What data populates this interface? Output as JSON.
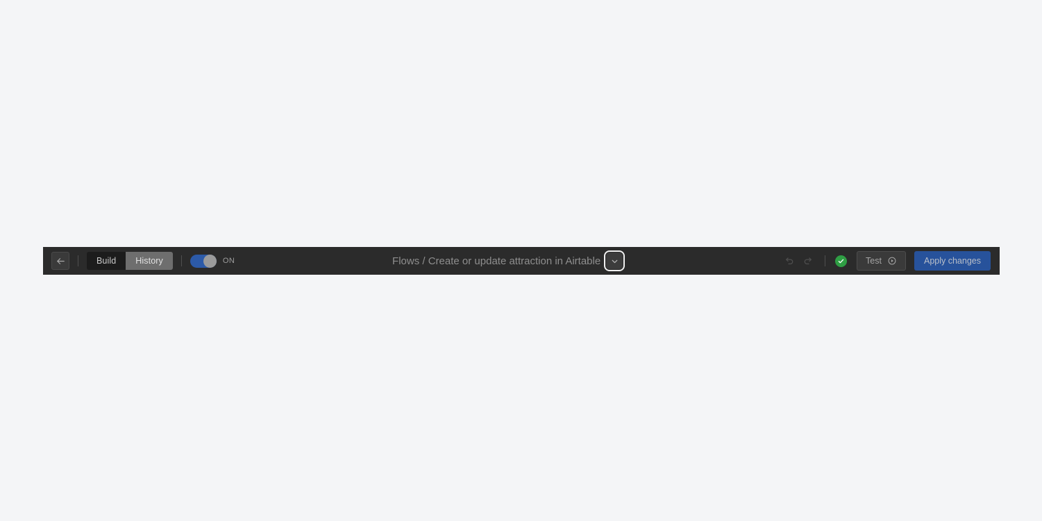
{
  "theme": {
    "page_background": "#f4f5f7",
    "toolbar_background": "#2b2b2b",
    "accent_blue": "#27529b",
    "toggle_on_blue": "#2c5aa8",
    "status_green": "#2f9e44",
    "muted_text": "#8e8e8e"
  },
  "toolbar": {
    "back_button": {
      "icon": "arrow-left-icon",
      "label": ""
    },
    "mode_tabs": [
      {
        "label": "Build",
        "active": true
      },
      {
        "label": "History",
        "active": false
      }
    ],
    "enable_toggle": {
      "label": "ON",
      "state": "on"
    },
    "title": "Flows / Create or update attraction in Airtable",
    "title_menu": {
      "icon": "chevron-down-icon",
      "focused": true
    },
    "undo": {
      "icon": "undo-icon",
      "enabled": false
    },
    "redo": {
      "icon": "redo-icon",
      "enabled": false
    },
    "status": {
      "icon": "check-circle-icon",
      "state": "valid"
    },
    "test_button": {
      "label": "Test",
      "icon": "play-circle-icon"
    },
    "apply_button": {
      "label": "Apply changes"
    }
  }
}
